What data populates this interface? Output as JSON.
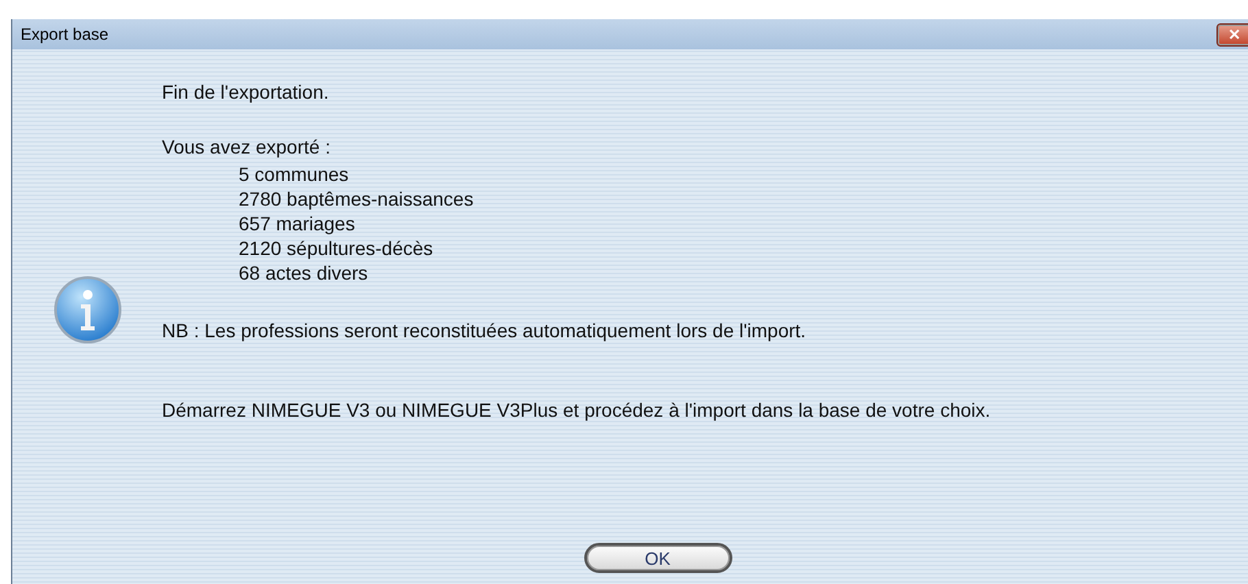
{
  "window": {
    "title": "Export base",
    "close": "✕"
  },
  "message": {
    "heading": "Fin de l'exportation.",
    "intro": "Vous avez exporté :",
    "items": [
      "5 communes",
      "2780 baptêmes-naissances",
      "657 mariages",
      "2120 sépultures-décès",
      "68 actes divers"
    ],
    "note": "NB : Les professions seront reconstituées automatiquement lors de l'import.",
    "instruction": "Démarrez NIMEGUE V3 ou NIMEGUE V3Plus et procédez à l'import dans la base de votre choix."
  },
  "buttons": [
    "OK"
  ]
}
